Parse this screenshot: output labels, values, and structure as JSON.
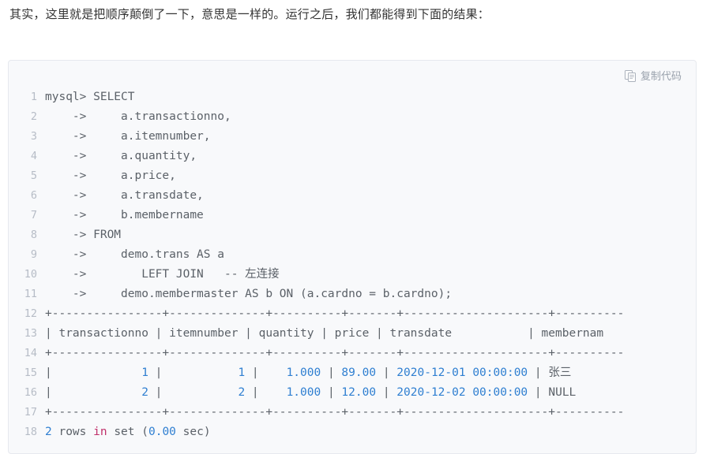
{
  "intro": {
    "text": "其实，这里就是把顺序颠倒了一下，意思是一样的。运行之后，我们都能得到下面的结果："
  },
  "code_block": {
    "copy_button_label": "复制代码",
    "copy_icon": "copy-icon",
    "language": "sql",
    "background_color": "#f8f9fb",
    "border_color": "#e6e9ee",
    "text_color": "#5b6168",
    "number_color": "#2f7fd1",
    "keyword_color": "#c0306a",
    "line_number_color": "#b6bcc6",
    "lines": [
      {
        "n": "1",
        "segments": [
          {
            "t": "mysql> SELECT",
            "c": "plain"
          }
        ]
      },
      {
        "n": "2",
        "segments": [
          {
            "t": "    ->     a.transactionno,",
            "c": "plain"
          }
        ]
      },
      {
        "n": "3",
        "segments": [
          {
            "t": "    ->     a.itemnumber,",
            "c": "plain"
          }
        ]
      },
      {
        "n": "4",
        "segments": [
          {
            "t": "    ->     a.quantity,",
            "c": "plain"
          }
        ]
      },
      {
        "n": "5",
        "segments": [
          {
            "t": "    ->     a.price,",
            "c": "plain"
          }
        ]
      },
      {
        "n": "6",
        "segments": [
          {
            "t": "    ->     a.transdate,",
            "c": "plain"
          }
        ]
      },
      {
        "n": "7",
        "segments": [
          {
            "t": "    ->     b.membername",
            "c": "plain"
          }
        ]
      },
      {
        "n": "8",
        "segments": [
          {
            "t": "    -> FROM",
            "c": "plain"
          }
        ]
      },
      {
        "n": "9",
        "segments": [
          {
            "t": "    ->     demo.trans AS a",
            "c": "plain"
          }
        ]
      },
      {
        "n": "10",
        "segments": [
          {
            "t": "    ->        LEFT JOIN   -- 左连接",
            "c": "plain"
          }
        ]
      },
      {
        "n": "11",
        "segments": [
          {
            "t": "    ->     demo.membermaster AS b ON (a.cardno = b.cardno);",
            "c": "plain"
          }
        ]
      },
      {
        "n": "12",
        "segments": [
          {
            "t": "+----------------+--------------+----------+-------+---------------------+----------",
            "c": "plain"
          }
        ]
      },
      {
        "n": "13",
        "segments": [
          {
            "t": "| transactionno | itemnumber | quantity | price | transdate           | membernam",
            "c": "plain"
          }
        ]
      },
      {
        "n": "14",
        "segments": [
          {
            "t": "+----------------+--------------+----------+-------+---------------------+----------",
            "c": "plain"
          }
        ]
      },
      {
        "n": "15",
        "segments": [
          {
            "t": "|",
            "c": "plain"
          },
          {
            "t": "             1",
            "c": "num"
          },
          {
            "t": " |",
            "c": "plain"
          },
          {
            "t": "           1",
            "c": "num"
          },
          {
            "t": " |",
            "c": "plain"
          },
          {
            "t": "    1.000",
            "c": "num"
          },
          {
            "t": " |",
            "c": "plain"
          },
          {
            "t": " 89.00",
            "c": "num"
          },
          {
            "t": " |",
            "c": "plain"
          },
          {
            "t": " 2020-12-01 00:00:00",
            "c": "num"
          },
          {
            "t": " | 张三",
            "c": "plain"
          }
        ]
      },
      {
        "n": "16",
        "segments": [
          {
            "t": "|",
            "c": "plain"
          },
          {
            "t": "             2",
            "c": "num"
          },
          {
            "t": " |",
            "c": "plain"
          },
          {
            "t": "           2",
            "c": "num"
          },
          {
            "t": " |",
            "c": "plain"
          },
          {
            "t": "    1.000",
            "c": "num"
          },
          {
            "t": " |",
            "c": "plain"
          },
          {
            "t": " 12.00",
            "c": "num"
          },
          {
            "t": " |",
            "c": "plain"
          },
          {
            "t": " 2020-12-02 00:00:00",
            "c": "num"
          },
          {
            "t": " | NULL",
            "c": "plain"
          }
        ]
      },
      {
        "n": "17",
        "segments": [
          {
            "t": "+----------------+--------------+----------+-------+---------------------+----------",
            "c": "plain"
          }
        ]
      },
      {
        "n": "18",
        "segments": [
          {
            "t": "2",
            "c": "num"
          },
          {
            "t": " rows ",
            "c": "plain"
          },
          {
            "t": "in",
            "c": "kw"
          },
          {
            "t": " set (",
            "c": "plain"
          },
          {
            "t": "0.00",
            "c": "num"
          },
          {
            "t": " sec)",
            "c": "plain"
          }
        ]
      }
    ],
    "result_table": {
      "columns": [
        "transactionno",
        "itemnumber",
        "quantity",
        "price",
        "transdate",
        "membername"
      ],
      "rows": [
        [
          "1",
          "1",
          "1.000",
          "89.00",
          "2020-12-01 00:00:00",
          "张三"
        ],
        [
          "2",
          "2",
          "1.000",
          "12.00",
          "2020-12-02 00:00:00",
          "NULL"
        ]
      ],
      "footer": "2 rows in set (0.00 sec)"
    }
  }
}
